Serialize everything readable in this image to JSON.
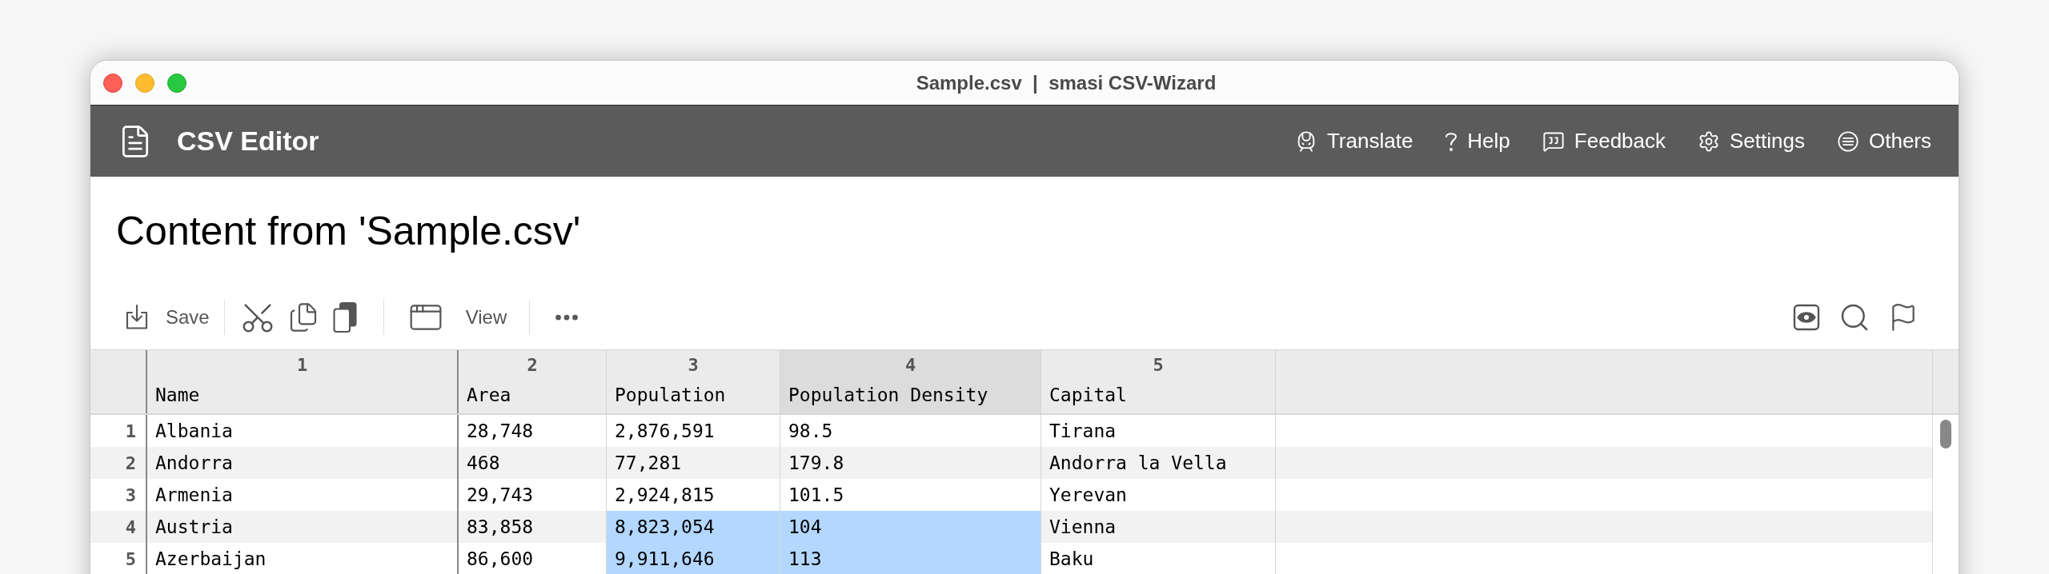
{
  "window": {
    "title": "Sample.csv  |  smasi CSV-Wizard"
  },
  "app_bar": {
    "title": "CSV Editor",
    "menu": [
      {
        "kind": "train",
        "label": "Translate"
      },
      {
        "kind": "help",
        "label": "Help"
      },
      {
        "kind": "feedback",
        "label": "Feedback"
      },
      {
        "kind": "settings",
        "label": "Settings"
      },
      {
        "kind": "others",
        "label": "Others"
      }
    ]
  },
  "heading": "Content from 'Sample.csv'",
  "toolbar": {
    "save": "Save",
    "view": "View"
  },
  "table": {
    "columns": [
      {
        "number": "1",
        "name": "Name",
        "selected": false
      },
      {
        "number": "2",
        "name": "Area",
        "selected": false
      },
      {
        "number": "3",
        "name": "Population",
        "selected": false
      },
      {
        "number": "4",
        "name": "Population Density",
        "selected": true
      },
      {
        "number": "5",
        "name": "Capital",
        "selected": false
      }
    ],
    "rows": [
      {
        "number": "1",
        "cells": [
          {
            "text": "Albania",
            "selected": false
          },
          {
            "text": "28,748",
            "selected": false
          },
          {
            "text": "2,876,591",
            "selected": false
          },
          {
            "text": "98.5",
            "selected": false
          },
          {
            "text": "Tirana",
            "selected": false
          }
        ]
      },
      {
        "number": "2",
        "cells": [
          {
            "text": "Andorra",
            "selected": false
          },
          {
            "text": "468",
            "selected": false
          },
          {
            "text": "77,281",
            "selected": false
          },
          {
            "text": "179.8",
            "selected": false
          },
          {
            "text": "Andorra la Vella",
            "selected": false
          }
        ]
      },
      {
        "number": "3",
        "cells": [
          {
            "text": "Armenia",
            "selected": false
          },
          {
            "text": "29,743",
            "selected": false
          },
          {
            "text": "2,924,815",
            "selected": false
          },
          {
            "text": "101.5",
            "selected": false
          },
          {
            "text": "Yerevan",
            "selected": false
          }
        ]
      },
      {
        "number": "4",
        "cells": [
          {
            "text": "Austria",
            "selected": false
          },
          {
            "text": "83,858",
            "selected": false
          },
          {
            "text": "8,823,054",
            "selected": true
          },
          {
            "text": "104",
            "selected": true
          },
          {
            "text": "Vienna",
            "selected": false
          }
        ]
      },
      {
        "number": "5",
        "cells": [
          {
            "text": "Azerbaijan",
            "selected": false
          },
          {
            "text": "86,600",
            "selected": false
          },
          {
            "text": "9,911,646",
            "selected": true
          },
          {
            "text": "113",
            "selected": true
          },
          {
            "text": "Baku",
            "selected": false
          }
        ]
      }
    ]
  }
}
